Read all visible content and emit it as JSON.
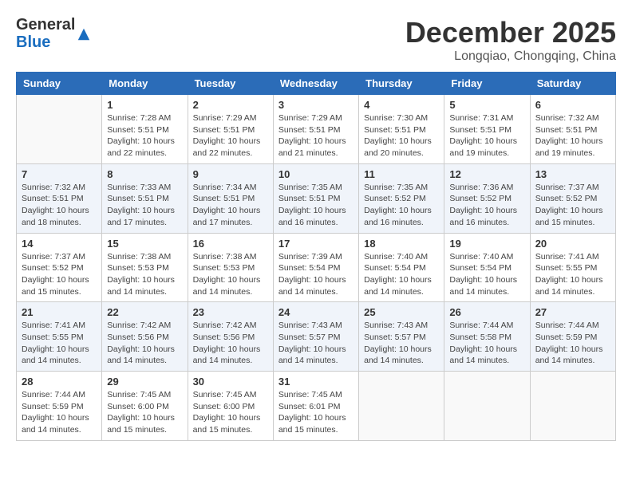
{
  "logo": {
    "general": "General",
    "blue": "Blue"
  },
  "header": {
    "month": "December 2025",
    "location": "Longqiao, Chongqing, China"
  },
  "weekdays": [
    "Sunday",
    "Monday",
    "Tuesday",
    "Wednesday",
    "Thursday",
    "Friday",
    "Saturday"
  ],
  "weeks": [
    [
      {
        "num": "",
        "info": ""
      },
      {
        "num": "1",
        "info": "Sunrise: 7:28 AM\nSunset: 5:51 PM\nDaylight: 10 hours\nand 22 minutes."
      },
      {
        "num": "2",
        "info": "Sunrise: 7:29 AM\nSunset: 5:51 PM\nDaylight: 10 hours\nand 22 minutes."
      },
      {
        "num": "3",
        "info": "Sunrise: 7:29 AM\nSunset: 5:51 PM\nDaylight: 10 hours\nand 21 minutes."
      },
      {
        "num": "4",
        "info": "Sunrise: 7:30 AM\nSunset: 5:51 PM\nDaylight: 10 hours\nand 20 minutes."
      },
      {
        "num": "5",
        "info": "Sunrise: 7:31 AM\nSunset: 5:51 PM\nDaylight: 10 hours\nand 19 minutes."
      },
      {
        "num": "6",
        "info": "Sunrise: 7:32 AM\nSunset: 5:51 PM\nDaylight: 10 hours\nand 19 minutes."
      }
    ],
    [
      {
        "num": "7",
        "info": "Sunrise: 7:32 AM\nSunset: 5:51 PM\nDaylight: 10 hours\nand 18 minutes."
      },
      {
        "num": "8",
        "info": "Sunrise: 7:33 AM\nSunset: 5:51 PM\nDaylight: 10 hours\nand 17 minutes."
      },
      {
        "num": "9",
        "info": "Sunrise: 7:34 AM\nSunset: 5:51 PM\nDaylight: 10 hours\nand 17 minutes."
      },
      {
        "num": "10",
        "info": "Sunrise: 7:35 AM\nSunset: 5:51 PM\nDaylight: 10 hours\nand 16 minutes."
      },
      {
        "num": "11",
        "info": "Sunrise: 7:35 AM\nSunset: 5:52 PM\nDaylight: 10 hours\nand 16 minutes."
      },
      {
        "num": "12",
        "info": "Sunrise: 7:36 AM\nSunset: 5:52 PM\nDaylight: 10 hours\nand 16 minutes."
      },
      {
        "num": "13",
        "info": "Sunrise: 7:37 AM\nSunset: 5:52 PM\nDaylight: 10 hours\nand 15 minutes."
      }
    ],
    [
      {
        "num": "14",
        "info": "Sunrise: 7:37 AM\nSunset: 5:52 PM\nDaylight: 10 hours\nand 15 minutes."
      },
      {
        "num": "15",
        "info": "Sunrise: 7:38 AM\nSunset: 5:53 PM\nDaylight: 10 hours\nand 14 minutes."
      },
      {
        "num": "16",
        "info": "Sunrise: 7:38 AM\nSunset: 5:53 PM\nDaylight: 10 hours\nand 14 minutes."
      },
      {
        "num": "17",
        "info": "Sunrise: 7:39 AM\nSunset: 5:54 PM\nDaylight: 10 hours\nand 14 minutes."
      },
      {
        "num": "18",
        "info": "Sunrise: 7:40 AM\nSunset: 5:54 PM\nDaylight: 10 hours\nand 14 minutes."
      },
      {
        "num": "19",
        "info": "Sunrise: 7:40 AM\nSunset: 5:54 PM\nDaylight: 10 hours\nand 14 minutes."
      },
      {
        "num": "20",
        "info": "Sunrise: 7:41 AM\nSunset: 5:55 PM\nDaylight: 10 hours\nand 14 minutes."
      }
    ],
    [
      {
        "num": "21",
        "info": "Sunrise: 7:41 AM\nSunset: 5:55 PM\nDaylight: 10 hours\nand 14 minutes."
      },
      {
        "num": "22",
        "info": "Sunrise: 7:42 AM\nSunset: 5:56 PM\nDaylight: 10 hours\nand 14 minutes."
      },
      {
        "num": "23",
        "info": "Sunrise: 7:42 AM\nSunset: 5:56 PM\nDaylight: 10 hours\nand 14 minutes."
      },
      {
        "num": "24",
        "info": "Sunrise: 7:43 AM\nSunset: 5:57 PM\nDaylight: 10 hours\nand 14 minutes."
      },
      {
        "num": "25",
        "info": "Sunrise: 7:43 AM\nSunset: 5:57 PM\nDaylight: 10 hours\nand 14 minutes."
      },
      {
        "num": "26",
        "info": "Sunrise: 7:44 AM\nSunset: 5:58 PM\nDaylight: 10 hours\nand 14 minutes."
      },
      {
        "num": "27",
        "info": "Sunrise: 7:44 AM\nSunset: 5:59 PM\nDaylight: 10 hours\nand 14 minutes."
      }
    ],
    [
      {
        "num": "28",
        "info": "Sunrise: 7:44 AM\nSunset: 5:59 PM\nDaylight: 10 hours\nand 14 minutes."
      },
      {
        "num": "29",
        "info": "Sunrise: 7:45 AM\nSunset: 6:00 PM\nDaylight: 10 hours\nand 15 minutes."
      },
      {
        "num": "30",
        "info": "Sunrise: 7:45 AM\nSunset: 6:00 PM\nDaylight: 10 hours\nand 15 minutes."
      },
      {
        "num": "31",
        "info": "Sunrise: 7:45 AM\nSunset: 6:01 PM\nDaylight: 10 hours\nand 15 minutes."
      },
      {
        "num": "",
        "info": ""
      },
      {
        "num": "",
        "info": ""
      },
      {
        "num": "",
        "info": ""
      }
    ]
  ]
}
